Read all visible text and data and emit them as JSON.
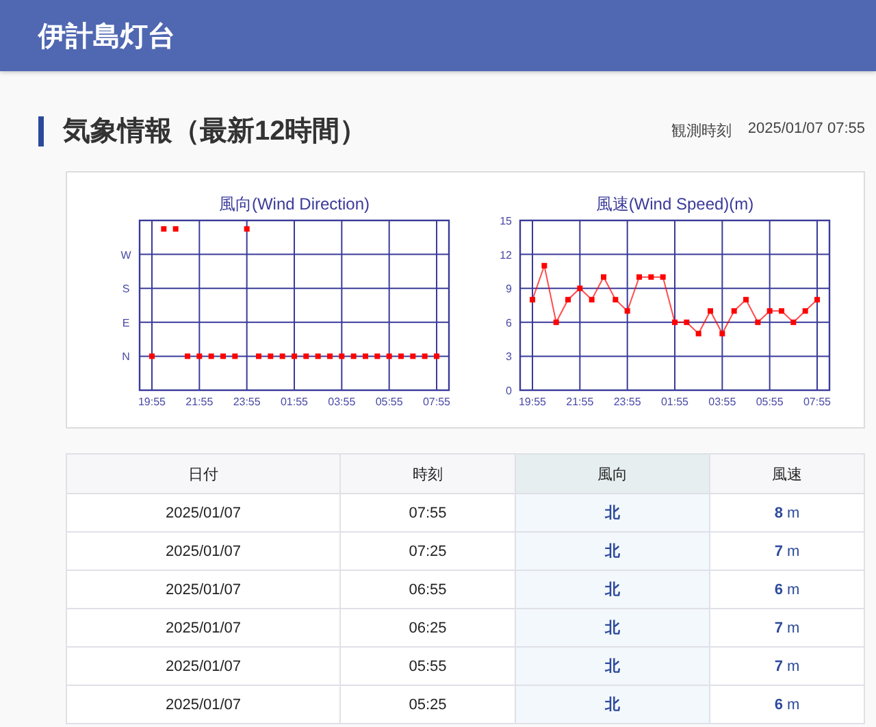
{
  "header": {
    "title": "伊計島灯台"
  },
  "section": {
    "title": "気象情報（最新12時間）",
    "observed_label": "観測時刻",
    "observed_time": "2025/01/07 07:55"
  },
  "direction_chart": {
    "title": "風向(Wind Direction)",
    "y_labels": [
      "W",
      "S",
      "E",
      "N"
    ],
    "x_labels": [
      "19:55",
      "21:55",
      "23:55",
      "01:55",
      "03:55",
      "05:55",
      "07:55"
    ]
  },
  "charts": [
    {
      "chart_data": {
        "type": "line",
        "title": "風速(Wind Speed)(m)",
        "grid": true,
        "categories": [
          "19:55",
          null,
          null,
          null,
          "21:55",
          null,
          null,
          null,
          "23:55",
          null,
          null,
          null,
          "01:55",
          null,
          null,
          null,
          "03:55",
          null,
          null,
          null,
          "05:55",
          null,
          null,
          null,
          "07:55"
        ],
        "series": [
          {
            "color": "#ff0000",
            "marker": "square",
            "values": [
              8,
              11,
              6,
              8,
              9,
              8,
              10,
              8,
              7,
              10,
              10,
              10,
              6,
              6,
              5,
              7,
              5,
              7,
              8,
              6,
              7,
              7,
              6,
              7,
              8
            ]
          }
        ],
        "ylim": [
          0,
          15
        ],
        "yticks": [
          0,
          3,
          6,
          9,
          12,
          15
        ]
      }
    }
  ],
  "table": {
    "columns": [
      {
        "label": "日付",
        "highlighted": false
      },
      {
        "label": "時刻",
        "highlighted": false
      },
      {
        "label": "風向",
        "highlighted": true
      },
      {
        "label": "風速",
        "highlighted": false
      }
    ],
    "rows": [
      {
        "date": "2025/01/07",
        "time": "07:55",
        "direction": "北",
        "speed": "**8** m"
      },
      {
        "date": "2025/01/07",
        "time": "07:25",
        "direction": "北",
        "speed": "**7** m"
      },
      {
        "date": "2025/01/07",
        "time": "06:55",
        "direction": "北",
        "speed": "**6** m"
      },
      {
        "date": "2025/01/07",
        "time": "06:25",
        "direction": "北",
        "speed": "**7** m"
      },
      {
        "date": "2025/01/07",
        "time": "05:55",
        "direction": "北",
        "speed": "**7** m"
      },
      {
        "date": "2025/01/07",
        "time": "05:25",
        "direction": "北",
        "speed": "**6** m"
      }
    ]
  }
}
